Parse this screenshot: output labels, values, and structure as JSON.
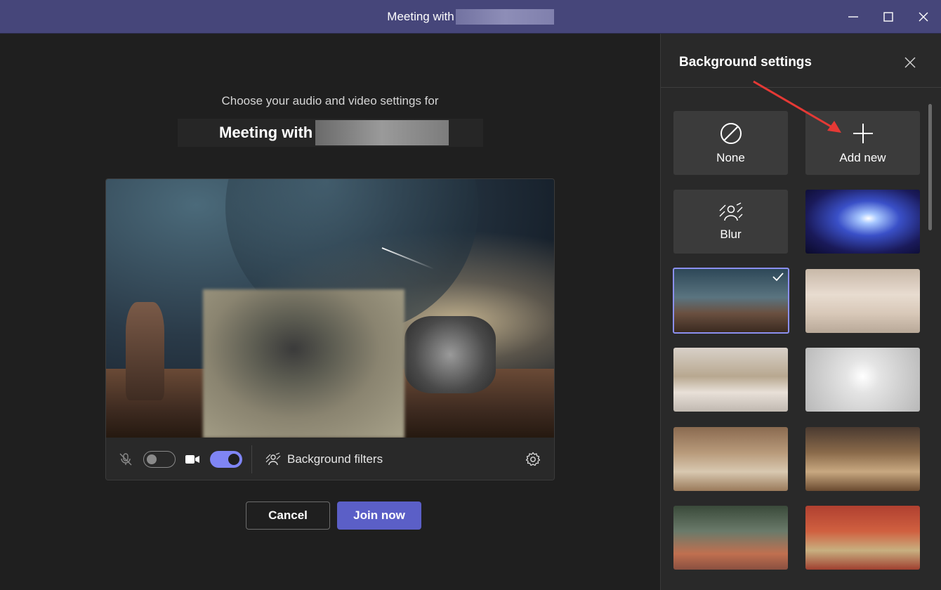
{
  "window": {
    "title": "Meeting with",
    "minimize_label": "Minimize",
    "maximize_label": "Maximize",
    "close_label": "Close"
  },
  "prejoin": {
    "intro": "Choose your audio and video settings for",
    "meeting_name": "Meeting with",
    "background_filters_label": "Background filters",
    "cancel_label": "Cancel",
    "join_label": "Join now",
    "mic_enabled": false,
    "camera_enabled": true
  },
  "background_panel": {
    "title": "Background settings",
    "options": [
      {
        "label": "None",
        "icon": "none-icon",
        "type": "option"
      },
      {
        "label": "Add new",
        "icon": "plus-icon",
        "type": "option"
      },
      {
        "label": "Blur",
        "icon": "blur-icon",
        "type": "option"
      },
      {
        "label": "",
        "type": "image",
        "thumb": "space",
        "selected": false
      },
      {
        "label": "",
        "type": "image",
        "thumb": "desert",
        "selected": true
      },
      {
        "label": "",
        "type": "image",
        "thumb": "room1",
        "selected": false
      },
      {
        "label": "",
        "type": "image",
        "thumb": "room2",
        "selected": false
      },
      {
        "label": "",
        "type": "image",
        "thumb": "room3",
        "selected": false
      },
      {
        "label": "",
        "type": "image",
        "thumb": "room4",
        "selected": false
      },
      {
        "label": "",
        "type": "image",
        "thumb": "room5",
        "selected": false
      },
      {
        "label": "",
        "type": "image",
        "thumb": "room6",
        "selected": false
      },
      {
        "label": "",
        "type": "image",
        "thumb": "room7",
        "selected": false
      }
    ]
  },
  "colors": {
    "titlebar": "#46467a",
    "accent": "#5b5fc7",
    "toggle_on": "#7f85f5",
    "annotation_arrow": "#e53935"
  }
}
